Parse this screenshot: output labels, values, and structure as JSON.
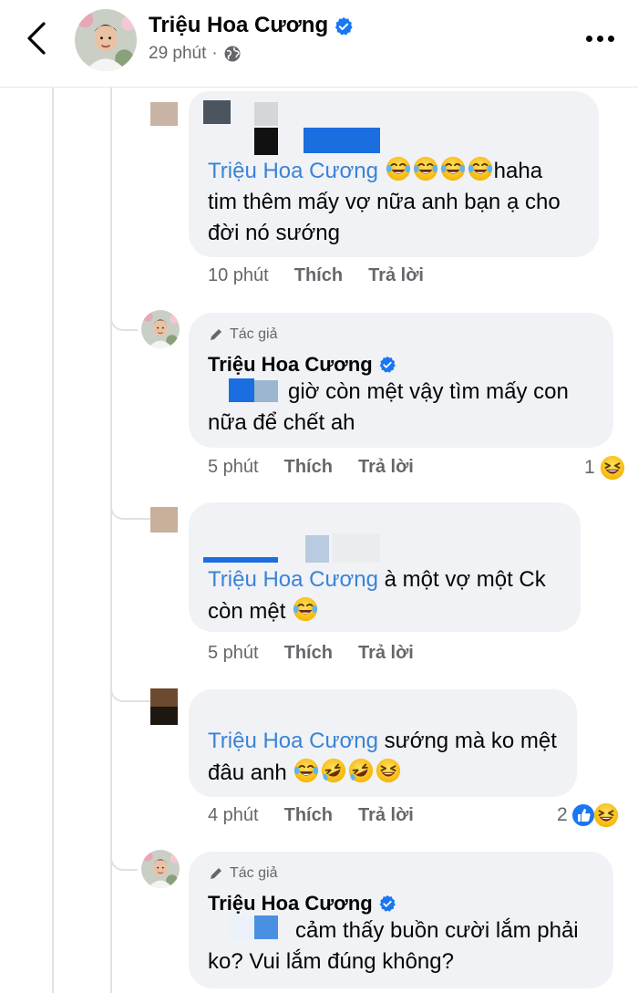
{
  "header": {
    "name": "Triệu Hoa Cương",
    "time": "29 phút",
    "separator": "·",
    "icons": [
      "back-arrow-icon",
      "verified-badge-icon",
      "globe-icon",
      "more-options-icon"
    ]
  },
  "comments": [
    {
      "mention": "Triệu Hoa Cương",
      "text_before_emoji": "",
      "emojis": [
        "laughing-tears",
        "laughing-tears",
        "laughing-tears",
        "laughing-tears"
      ],
      "text_line1_rest": "haha",
      "text_line2": "tim thêm mấy vợ nữa anh bạn ạ cho",
      "text_line3": "đời nó sướng",
      "time": "10 phút",
      "like": "Thích",
      "reply": "Trả lời"
    },
    {
      "author_tag": "Tác giả",
      "name": "Triệu Hoa Cương",
      "text_line1": "giờ còn mệt vậy tìm mấy con",
      "text_line2": "nữa để chết ah",
      "time": "5 phút",
      "like": "Thích",
      "reply": "Trả lời",
      "react_count": "1"
    },
    {
      "mention": "Triệu Hoa Cương",
      "text_line1": "à một vợ một Ck",
      "text_line2": "còn mệt",
      "time": "5 phút",
      "like": "Thích",
      "reply": "Trả lời"
    },
    {
      "mention": "Triệu Hoa Cương",
      "text_line1": "sướng mà ko mệt",
      "text_line2": "đâu anh",
      "time": "4 phút",
      "like": "Thích",
      "reply": "Trả lời",
      "react_count": "2"
    },
    {
      "author_tag": "Tác giả",
      "name": "Triệu Hoa Cương",
      "text_line1": "cảm thấy buồn cười lắm phải",
      "text_line2": "ko? Vui lắm đúng không?"
    }
  ],
  "colors": {
    "mention": "#3a83d6",
    "bubble": "#f0f2f5",
    "muted": "#65676b",
    "verified": "#1877f2"
  }
}
